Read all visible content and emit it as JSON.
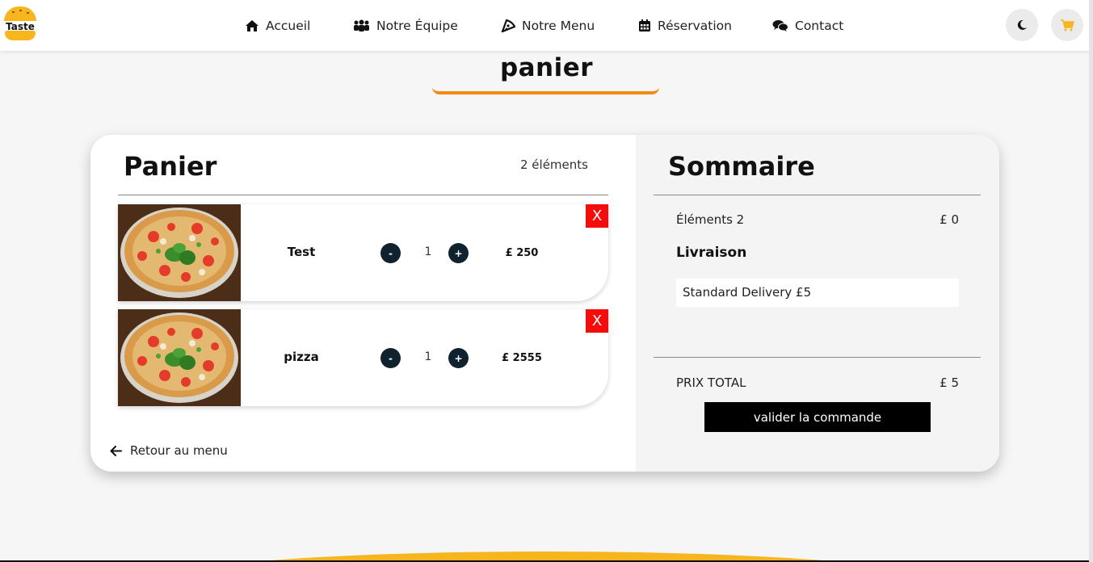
{
  "brand": {
    "logo_text": "Taste"
  },
  "nav": {
    "items": [
      {
        "label": "Accueil",
        "icon": "home-icon"
      },
      {
        "label": "Notre Équipe",
        "icon": "users-icon"
      },
      {
        "label": "Notre Menu",
        "icon": "pizza-icon"
      },
      {
        "label": "Réservation",
        "icon": "calendar-icon"
      },
      {
        "label": "Contact",
        "icon": "comments-icon"
      }
    ],
    "theme_toggle_icon": "moon-icon",
    "cart_icon": "cart-icon"
  },
  "page": {
    "title": "panier"
  },
  "cart": {
    "heading": "Panier",
    "count_label": "2 éléments",
    "items": [
      {
        "name": "Test",
        "qty": "1",
        "price": "£ 250",
        "minus": "-",
        "plus": "+",
        "remove": "X"
      },
      {
        "name": "pizza",
        "qty": "1",
        "price": "£ 2555",
        "minus": "-",
        "plus": "+",
        "remove": "X"
      }
    ],
    "back_label": "Retour au menu"
  },
  "summary": {
    "heading": "Sommaire",
    "items_label": "Éléments 2",
    "items_value": "£ 0",
    "delivery_heading": "Livraison",
    "delivery_selected": "Standard Delivery £5",
    "total_label": "PRIX TOTAL",
    "total_value": "£ 5",
    "checkout_label": "valider la commande"
  },
  "colors": {
    "accent_orange": "#f38a12",
    "brand_yellow": "#f7b51e",
    "remove_red": "#f80b0b",
    "qty_button": "#10222e"
  }
}
